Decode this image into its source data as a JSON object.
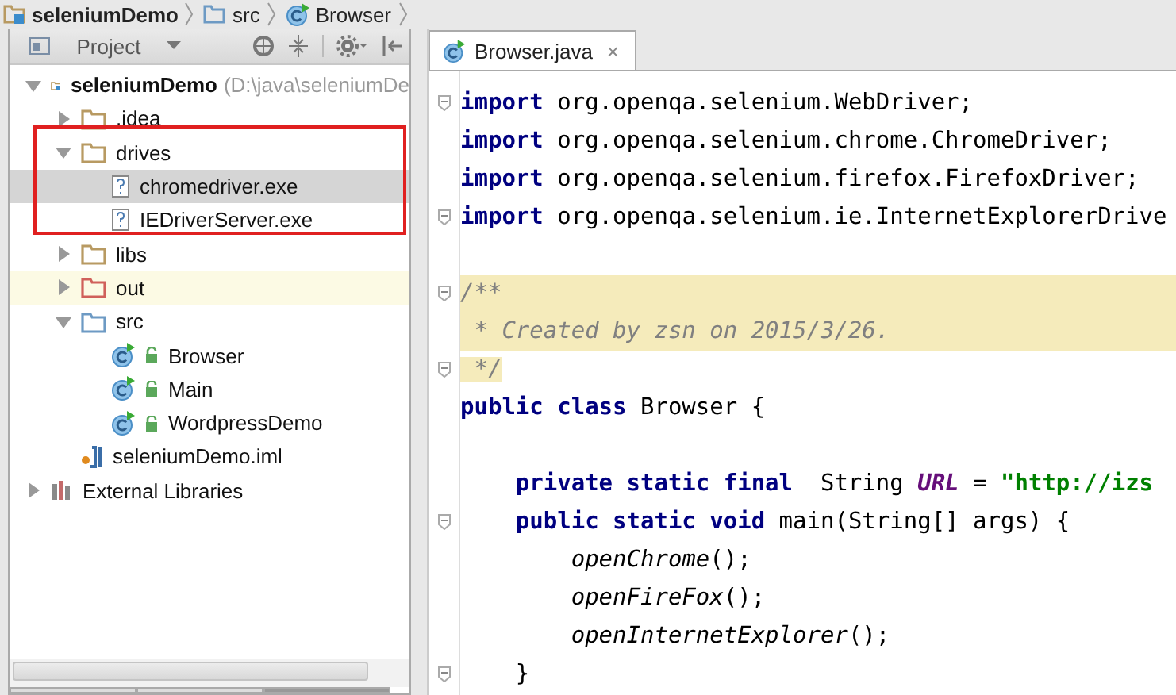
{
  "breadcrumb": [
    {
      "label": "seleniumDemo",
      "kind": "module"
    },
    {
      "label": "src",
      "kind": "folder-source"
    },
    {
      "label": "Browser",
      "kind": "class"
    }
  ],
  "project_panel": {
    "title": "Project",
    "tree": [
      {
        "name": "seleniumDemo",
        "hint": "(D:\\java\\seleniumDe",
        "kind": "module",
        "expanded": true,
        "selected": false,
        "children": [
          {
            "name": ".idea",
            "kind": "folder",
            "expanded": false,
            "selected": false
          },
          {
            "name": "drives",
            "kind": "folder",
            "expanded": true,
            "selected": false,
            "children": [
              {
                "name": "chromedriver.exe",
                "kind": "file-unknown",
                "selected": true
              },
              {
                "name": "IEDriverServer.exe",
                "kind": "file-unknown",
                "selected": false
              }
            ]
          },
          {
            "name": "libs",
            "kind": "folder",
            "expanded": false,
            "selected": false
          },
          {
            "name": "out",
            "kind": "folder-excluded",
            "expanded": false,
            "selected": false,
            "highlighted": true
          },
          {
            "name": "src",
            "kind": "folder-source",
            "expanded": true,
            "selected": false,
            "children": [
              {
                "name": "Browser",
                "kind": "class",
                "selected": false
              },
              {
                "name": "Main",
                "kind": "class",
                "selected": false
              },
              {
                "name": "WordpressDemo",
                "kind": "class",
                "selected": false
              }
            ]
          },
          {
            "name": "seleniumDemo.iml",
            "kind": "iml",
            "selected": false
          }
        ]
      },
      {
        "name": "External Libraries",
        "kind": "libraries",
        "expanded": false,
        "selected": false
      }
    ]
  },
  "editor": {
    "tabs": [
      {
        "label": "Browser.java",
        "selected": true,
        "close": "×"
      }
    ],
    "lines": [
      {
        "fold": true,
        "parts": [
          {
            "kind": "keyword",
            "text": "import"
          },
          {
            "kind": "plain",
            "text": " org.openqa.selenium.WebDriver;"
          }
        ]
      },
      {
        "parts": [
          {
            "kind": "keyword",
            "text": "import"
          },
          {
            "kind": "plain",
            "text": " org.openqa.selenium.chrome.ChromeDriver;"
          }
        ]
      },
      {
        "parts": [
          {
            "kind": "keyword",
            "text": "import"
          },
          {
            "kind": "plain",
            "text": " org.openqa.selenium.firefox.FirefoxDriver;"
          }
        ]
      },
      {
        "fold": true,
        "parts": [
          {
            "kind": "keyword",
            "text": "import"
          },
          {
            "kind": "plain",
            "text": " org.openqa.selenium.ie.InternetExplorerDrive"
          }
        ]
      },
      {
        "fold": true,
        "band": true,
        "gap_before": true,
        "parts": [
          {
            "kind": "comment",
            "text": "/**"
          }
        ]
      },
      {
        "band": true,
        "parts": [
          {
            "kind": "comment",
            "text": " * Created by zsn on 2015/3/26."
          }
        ]
      },
      {
        "fold": true,
        "parts": [
          {
            "kind": "comment",
            "text": " */"
          }
        ]
      },
      {
        "parts": [
          {
            "kind": "keyword",
            "text": "public class"
          },
          {
            "kind": "plain",
            "text": " Browser {"
          }
        ]
      },
      {
        "gap_before": true,
        "parts": [
          {
            "kind": "keyword",
            "text": "    private static final"
          },
          {
            "kind": "plain",
            "text": "  String "
          },
          {
            "kind": "field",
            "text": "URL"
          },
          {
            "kind": "plain",
            "text": " = "
          },
          {
            "kind": "string",
            "text": "\"http://izs"
          }
        ]
      },
      {
        "fold": true,
        "parts": [
          {
            "kind": "keyword",
            "text": "    public static void"
          },
          {
            "kind": "plain",
            "text": " main(String[] args) {"
          }
        ]
      },
      {
        "parts": [
          {
            "kind": "call",
            "text": "        openChrome"
          },
          {
            "kind": "plain",
            "text": "();"
          }
        ]
      },
      {
        "parts": [
          {
            "kind": "call",
            "text": "        openFireFox"
          },
          {
            "kind": "plain",
            "text": "();"
          }
        ]
      },
      {
        "parts": [
          {
            "kind": "call",
            "text": "        openInternetExplorer"
          },
          {
            "kind": "plain",
            "text": "();"
          }
        ]
      },
      {
        "fold": true,
        "parts": [
          {
            "kind": "plain",
            "text": "    }"
          }
        ]
      }
    ]
  }
}
